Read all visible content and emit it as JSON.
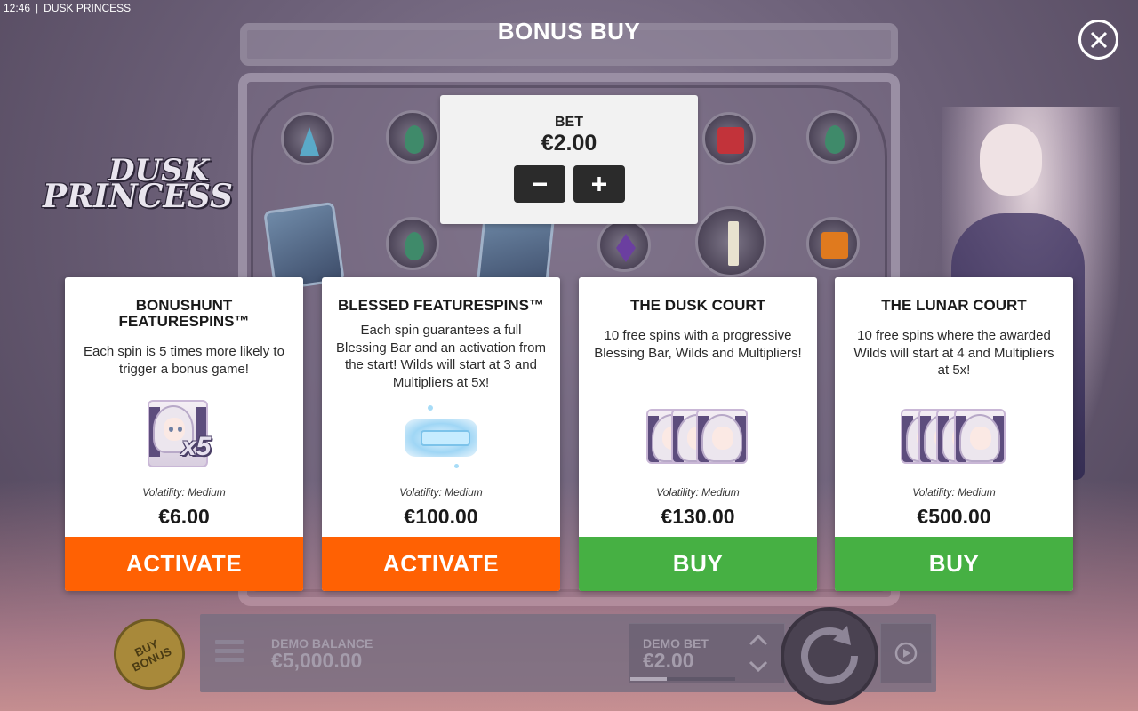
{
  "status_bar": {
    "time": "12:46",
    "separator": "|",
    "game_name": "DUSK PRINCESS"
  },
  "logo": {
    "line1": "DUSK",
    "line2": "PRINCESS"
  },
  "title": "BONUS BUY",
  "bet": {
    "label": "BET",
    "value": "€2.00"
  },
  "cards": [
    {
      "title": "BONUSHUNT FEATURESPINS™",
      "description": "Each spin is 5 times more likely to trigger a bonus game!",
      "art_label": "x5",
      "volatility": "Volatility: Medium",
      "price": "€6.00",
      "action": "ACTIVATE",
      "action_color": "#ff6103"
    },
    {
      "title": "BLESSED FEATURESPINS™",
      "description": "Each spin guarantees a full Blessing Bar and an activation from the start! Wilds will start at 3 and Multipliers at 5x!",
      "volatility": "Volatility: Medium",
      "price": "€100.00",
      "action": "ACTIVATE",
      "action_color": "#ff6103"
    },
    {
      "title": "THE DUSK COURT",
      "description": "10 free spins with a progressive Blessing Bar, Wilds and Multipliers!",
      "volatility": "Volatility: Medium",
      "price": "€130.00",
      "action": "BUY",
      "action_color": "#46b043"
    },
    {
      "title": "THE LUNAR COURT",
      "description": "10 free spins where the awarded Wilds will start at 4 and Multipliers at 5x!",
      "volatility": "Volatility: Medium",
      "price": "€500.00",
      "action": "BUY",
      "action_color": "#46b043"
    }
  ],
  "bottom_bar": {
    "buy_bonus_line1": "BUY",
    "buy_bonus_line2": "BONUS",
    "balance_label": "DEMO BALANCE",
    "balance_value": "€5,000.00",
    "bet_label": "DEMO BET",
    "bet_value": "€2.00",
    "bet_level": 0.35
  },
  "icons": {
    "close": "close-icon",
    "minus": "minus-icon",
    "plus": "plus-icon",
    "menu": "hamburger-menu-icon",
    "spin": "spin-arrow-icon",
    "autoplay": "autoplay-icon",
    "bet_up": "chevron-up-icon",
    "bet_down": "chevron-down-icon"
  },
  "colors": {
    "activate": "#ff6103",
    "buy": "#46b043",
    "panel": "#f2f2f2"
  }
}
